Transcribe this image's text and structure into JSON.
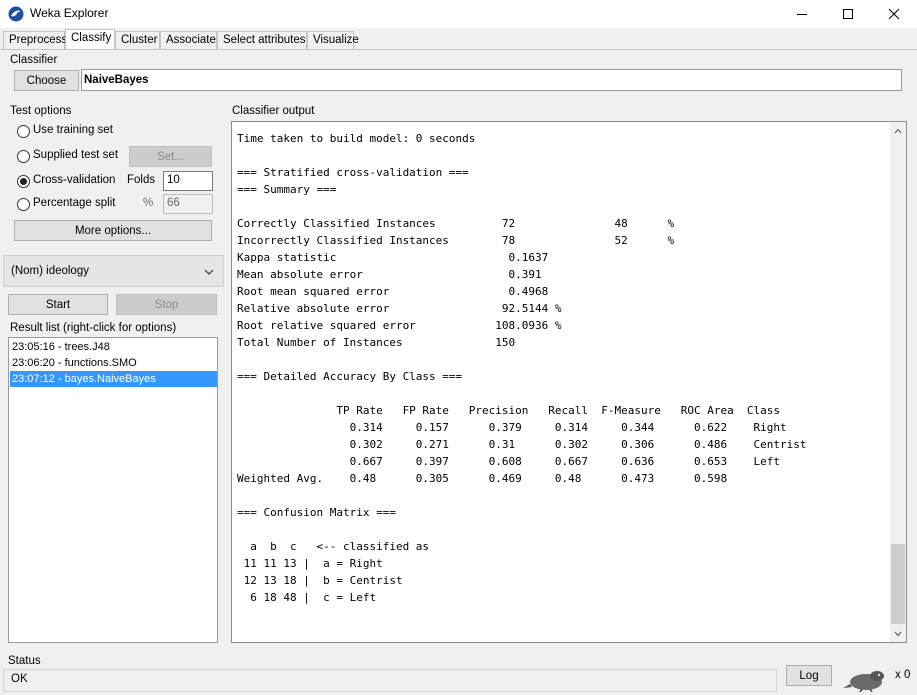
{
  "window": {
    "title": "Weka Explorer"
  },
  "tabs": [
    "Preprocess",
    "Classify",
    "Cluster",
    "Associate",
    "Select attributes",
    "Visualize"
  ],
  "classifier": {
    "group_title": "Classifier",
    "choose_label": "Choose",
    "name": "NaiveBayes"
  },
  "test_options": {
    "group_title": "Test options",
    "use_training_set": "Use training set",
    "supplied_test_set": "Supplied test set",
    "set_button": "Set...",
    "cross_validation": "Cross-validation",
    "folds_label": "Folds",
    "folds_value": "10",
    "percentage_split": "Percentage split",
    "percent_label": "%",
    "percent_value": "66",
    "more_options": "More options..."
  },
  "class_attribute": "(Nom) ideology",
  "start_label": "Start",
  "stop_label": "Stop",
  "result_list": {
    "title": "Result list (right-click for options)",
    "items": [
      "23:05:16 - trees.J48",
      "23:06:20 - functions.SMO",
      "23:07:12 - bayes.NaiveBayes"
    ]
  },
  "output": {
    "title": "Classifier output",
    "lines": [
      "Time taken to build model: 0 seconds",
      "",
      "=== Stratified cross-validation ===",
      "=== Summary ===",
      "",
      "Correctly Classified Instances          72               48      %",
      "Incorrectly Classified Instances        78               52      %",
      "Kappa statistic                          0.1637",
      "Mean absolute error                      0.391",
      "Root mean squared error                  0.4968",
      "Relative absolute error                 92.5144 %",
      "Root relative squared error            108.0936 %",
      "Total Number of Instances              150",
      "",
      "=== Detailed Accuracy By Class ===",
      "",
      "               TP Rate   FP Rate   Precision   Recall  F-Measure   ROC Area  Class",
      "                 0.314     0.157      0.379     0.314     0.344      0.622    Right",
      "                 0.302     0.271      0.31      0.302     0.306      0.486    Centrist",
      "                 0.667     0.397      0.608     0.667     0.636      0.653    Left",
      "Weighted Avg.    0.48      0.305      0.469     0.48      0.473      0.598",
      "",
      "=== Confusion Matrix ===",
      "",
      "  a  b  c   <-- classified as",
      " 11 11 13 |  a = Right",
      " 12 13 18 |  b = Centrist",
      "  6 18 48 |  c = Left"
    ]
  },
  "status": {
    "title": "Status",
    "text": "OK",
    "log_label": "Log",
    "count": "x 0"
  },
  "colors": {
    "selection": "#3399ff",
    "background": "#f0f0f0"
  }
}
